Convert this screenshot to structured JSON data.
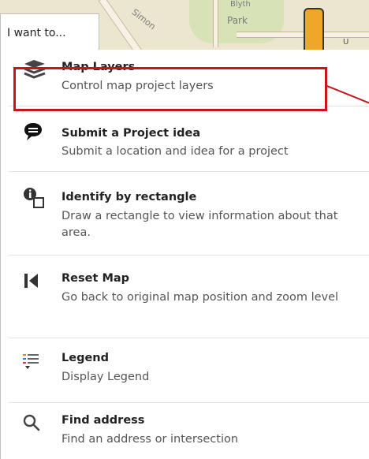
{
  "map": {
    "labels": {
      "simon": "Simon",
      "park": "Park",
      "blyth": "Blyth",
      "u": "U"
    }
  },
  "tab": {
    "label": "I want to..."
  },
  "menu": [
    {
      "id": "map-layers",
      "title": "Map Layers",
      "description": "Control map project layers",
      "icon": "layers-icon"
    },
    {
      "id": "submit-project-idea",
      "title": "Submit a Project idea",
      "description": "Submit a location and idea for a project",
      "icon": "speech-bubble-icon"
    },
    {
      "id": "identify-by-rectangle",
      "title": "Identify by rectangle",
      "description": "Draw a rectangle to view information about that area.",
      "icon": "info-rectangle-icon"
    },
    {
      "id": "reset-map",
      "title": "Reset Map",
      "description": "Go back to original map position and zoom level",
      "icon": "reset-icon"
    },
    {
      "id": "legend",
      "title": "Legend",
      "description": "Display Legend",
      "icon": "legend-icon"
    },
    {
      "id": "find-address",
      "title": "Find address",
      "description": "Find an address or intersection",
      "icon": "search-icon"
    }
  ],
  "highlight": {
    "color": "#c4161c"
  }
}
